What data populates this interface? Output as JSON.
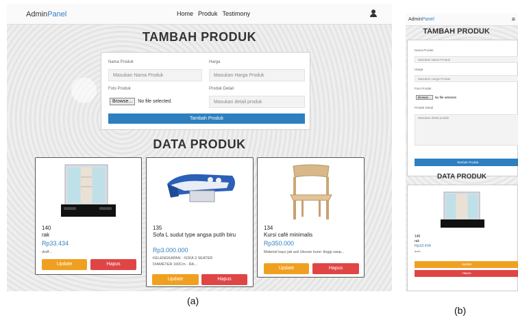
{
  "panel_a": {
    "brand": {
      "prefix": "Admin",
      "accent": "Panel"
    },
    "nav": [
      "Home",
      "Produk",
      "Testimony"
    ],
    "page_title": "TAMBAH PRODUK",
    "form": {
      "nama_label": "Nama Produk",
      "nama_placeholder": "Masukan Nama Produk",
      "harga_label": "Harga",
      "harga_placeholder": "Masukan Harga Produk",
      "foto_label": "Foto Produk",
      "browse_label": "Browse...",
      "file_status": "No file selected.",
      "detail_label": "Produk Detail",
      "detail_placeholder": "Masukan detail produk",
      "submit_label": "Tambah Produk"
    },
    "data_title": "DATA PRODUK",
    "products": [
      {
        "id": "140",
        "name": "rak",
        "price": "Rp33.434",
        "desc": "dvdf...",
        "image": "shelf-cabinet"
      },
      {
        "id": "135",
        "name": "Sofa L sudut type angsa putih biru",
        "price": "Rp3.000.000",
        "desc": "KELENGKAPAN : SOFA 3 SEATER DIAMETER 160Cm - RA...",
        "image": "sofa"
      },
      {
        "id": "134",
        "name": "Kursi café minimalis",
        "price": "Rp350.000",
        "desc": "Material kayu jati asli Ukuran kursi: tinggi sanp...",
        "image": "wooden-chair"
      }
    ],
    "update_label": "Update",
    "delete_label": "Hapus"
  },
  "panel_b": {
    "brand": {
      "prefix": "Admin",
      "accent": "Panel"
    },
    "menu_icon": "hamburger-icon",
    "page_title": "TAMBAH PRODUK",
    "form": {
      "nama_label": "Nama Produk",
      "nama_placeholder": "Masukan Nama Produk",
      "harga_label": "Harga",
      "harga_placeholder": "Masukan Harga Produk",
      "foto_label": "Foto Produk",
      "browse_label": "Browse...",
      "file_status": "No file selected.",
      "detail_label": "Produk Detail",
      "detail_placeholder": "Masukan detail produk",
      "submit_label": "Tambah Produk"
    },
    "data_title": "DATA PRODUK",
    "product": {
      "id": "140",
      "name": "rak",
      "price": "Rp33.434",
      "desc": "dvdf..."
    },
    "update_label": "Update",
    "delete_label": "Hapus"
  },
  "captions": {
    "a": "(a)",
    "b": "(b)"
  },
  "colors": {
    "accent": "#2f7fc1",
    "update": "#f0a020",
    "delete": "#e04545",
    "submit": "#2d7fbf"
  }
}
